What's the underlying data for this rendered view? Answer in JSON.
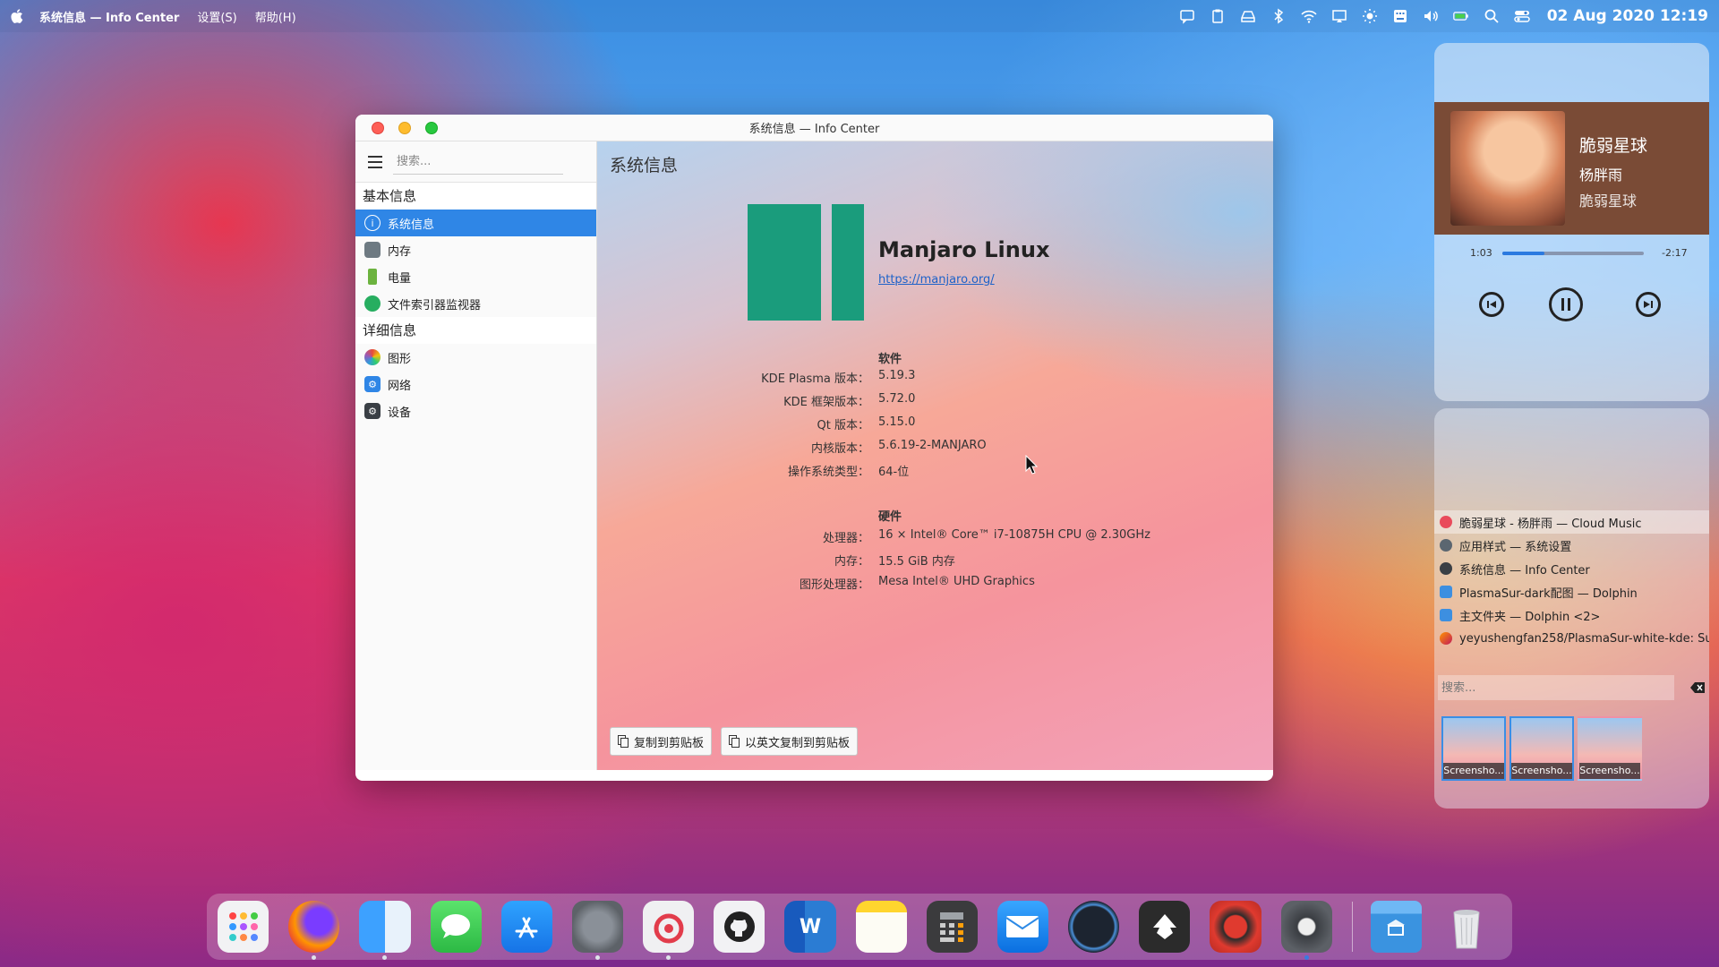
{
  "menubar": {
    "app_title": "系统信息 — Info Center",
    "menus": [
      "设置(S)",
      "帮助(H)"
    ],
    "clock": "02 Aug 2020 12:19",
    "tray_icons": [
      "chat-icon",
      "clipboard-icon",
      "drive-icon",
      "bluetooth-icon",
      "wifi-icon",
      "display-icon",
      "brightness-icon",
      "keyboard-icon",
      "volume-icon",
      "battery-icon",
      "search-icon",
      "control-center-icon"
    ]
  },
  "window": {
    "title": "系统信息 — Info Center",
    "sidebar": {
      "search_placeholder": "搜索...",
      "group1": "基本信息",
      "group1_items": [
        "系统信息",
        "内存",
        "电量",
        "文件索引器监视器"
      ],
      "group2": "详细信息",
      "group2_items": [
        "图形",
        "网络",
        "设备"
      ]
    },
    "content": {
      "title": "系统信息",
      "distro": "Manjaro Linux",
      "url": "https://manjaro.org/",
      "software_head": "软件",
      "software": [
        {
          "k": "KDE Plasma 版本：",
          "v": "5.19.3"
        },
        {
          "k": "KDE 框架版本：",
          "v": "5.72.0"
        },
        {
          "k": "Qt 版本：",
          "v": "5.15.0"
        },
        {
          "k": "内核版本：",
          "v": "5.6.19-2-MANJARO"
        },
        {
          "k": "操作系统类型：",
          "v": "64-位"
        }
      ],
      "hardware_head": "硬件",
      "hardware": [
        {
          "k": "处理器：",
          "v": "16 × Intel® Core™ i7-10875H CPU @ 2.30GHz"
        },
        {
          "k": "内存：",
          "v": "15.5 GiB 内存"
        },
        {
          "k": "图形处理器：",
          "v": "Mesa Intel® UHD Graphics"
        }
      ],
      "copy_button": "复制到剪贴板",
      "copy_en_button": "以英文复制到剪贴板"
    }
  },
  "music": {
    "title": "脆弱星球",
    "artist": "杨胖雨",
    "album": "脆弱星球",
    "elapsed": "1:03",
    "remaining": "-2:17",
    "progress": 0.3
  },
  "clipboard": {
    "items": [
      "脆弱星球 - 杨胖雨 — Cloud Music",
      "应用样式 — 系统设置",
      "系统信息 — Info Center",
      "PlasmaSur-dark配图 — Dolphin",
      "主文件夹 — Dolphin <2>",
      "yeyushengfan258/PlasmaSur-white-kde: Su..."
    ],
    "search_placeholder": "搜索...",
    "thumbs": [
      "Screensho...",
      "Screensho...",
      "Screensho..."
    ]
  },
  "dock": {
    "apps": [
      "launchpad",
      "firefox",
      "finder",
      "messages",
      "app-store",
      "system-preferences",
      "netease-music",
      "github",
      "word",
      "notes",
      "calculator",
      "mail",
      "monitor",
      "inkscape",
      "record",
      "settings"
    ],
    "folders": [
      "home-folder",
      "trash"
    ]
  }
}
